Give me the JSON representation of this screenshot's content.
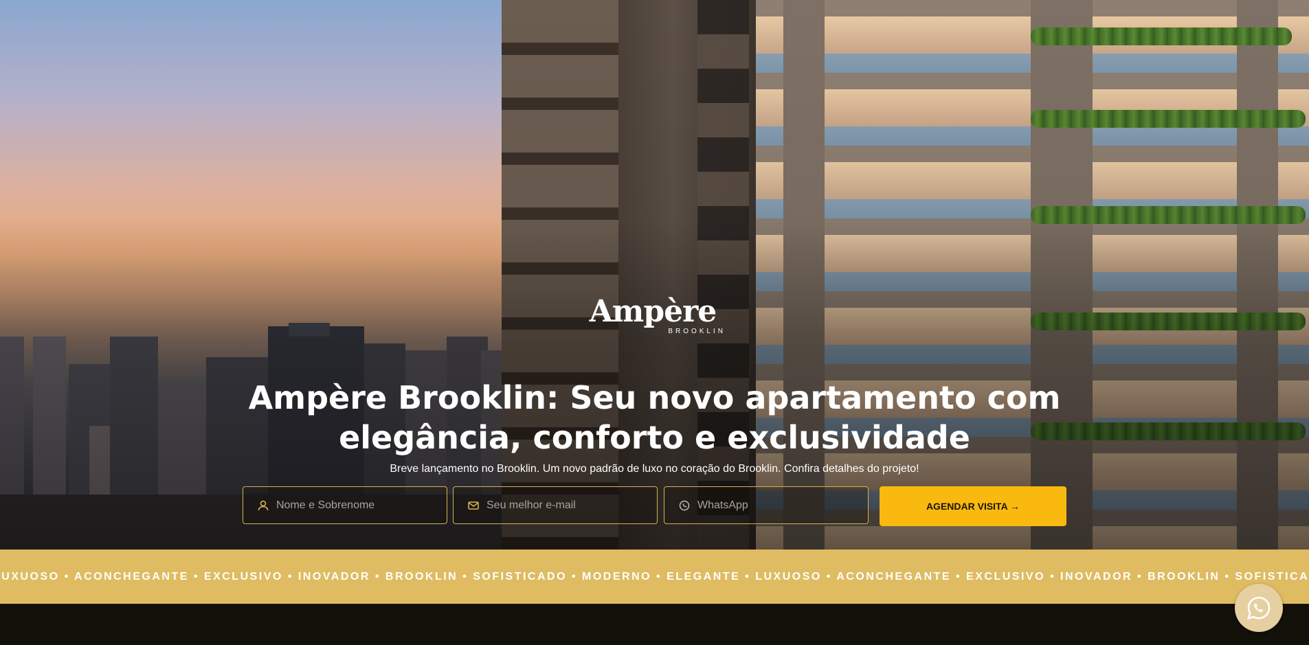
{
  "logo": {
    "brand": "Ampère",
    "location": "BROOKLIN"
  },
  "hero": {
    "headline_line1": "Ampère Brooklin: Seu novo apartamento com",
    "headline_line2": "elegância, conforto e exclusividade",
    "subheadline": "Breve lançamento no Brooklin. Um novo padrão de luxo no coração do Brooklin. Confira detalhes do projeto!"
  },
  "form": {
    "name_placeholder": "Nome e Sobrenome",
    "email_placeholder": "Seu melhor e-mail",
    "whatsapp_placeholder": "WhatsApp",
    "submit_label": "AGENDAR VISITA →",
    "name_icon": "user-icon",
    "email_icon": "mail-icon",
    "whatsapp_icon": "whatsapp-icon"
  },
  "ticker": {
    "text": "LUXUOSO • ACONCHEGANTE • EXCLUSIVO • INOVADOR • BROOKLIN • SOFISTICADO • MODERNO • ELEGANTE • LUXUOSO • ACONCHEGANTE • EXCLUSIVO • INOVADOR • BROOKLIN • SOFISTICADO"
  },
  "floating": {
    "whatsapp_icon": "whatsapp-icon"
  },
  "colors": {
    "accent": "#f9b90e",
    "gold_band": "#dfbb62",
    "field_border": "#d9b24f",
    "dark": "#14100a"
  }
}
